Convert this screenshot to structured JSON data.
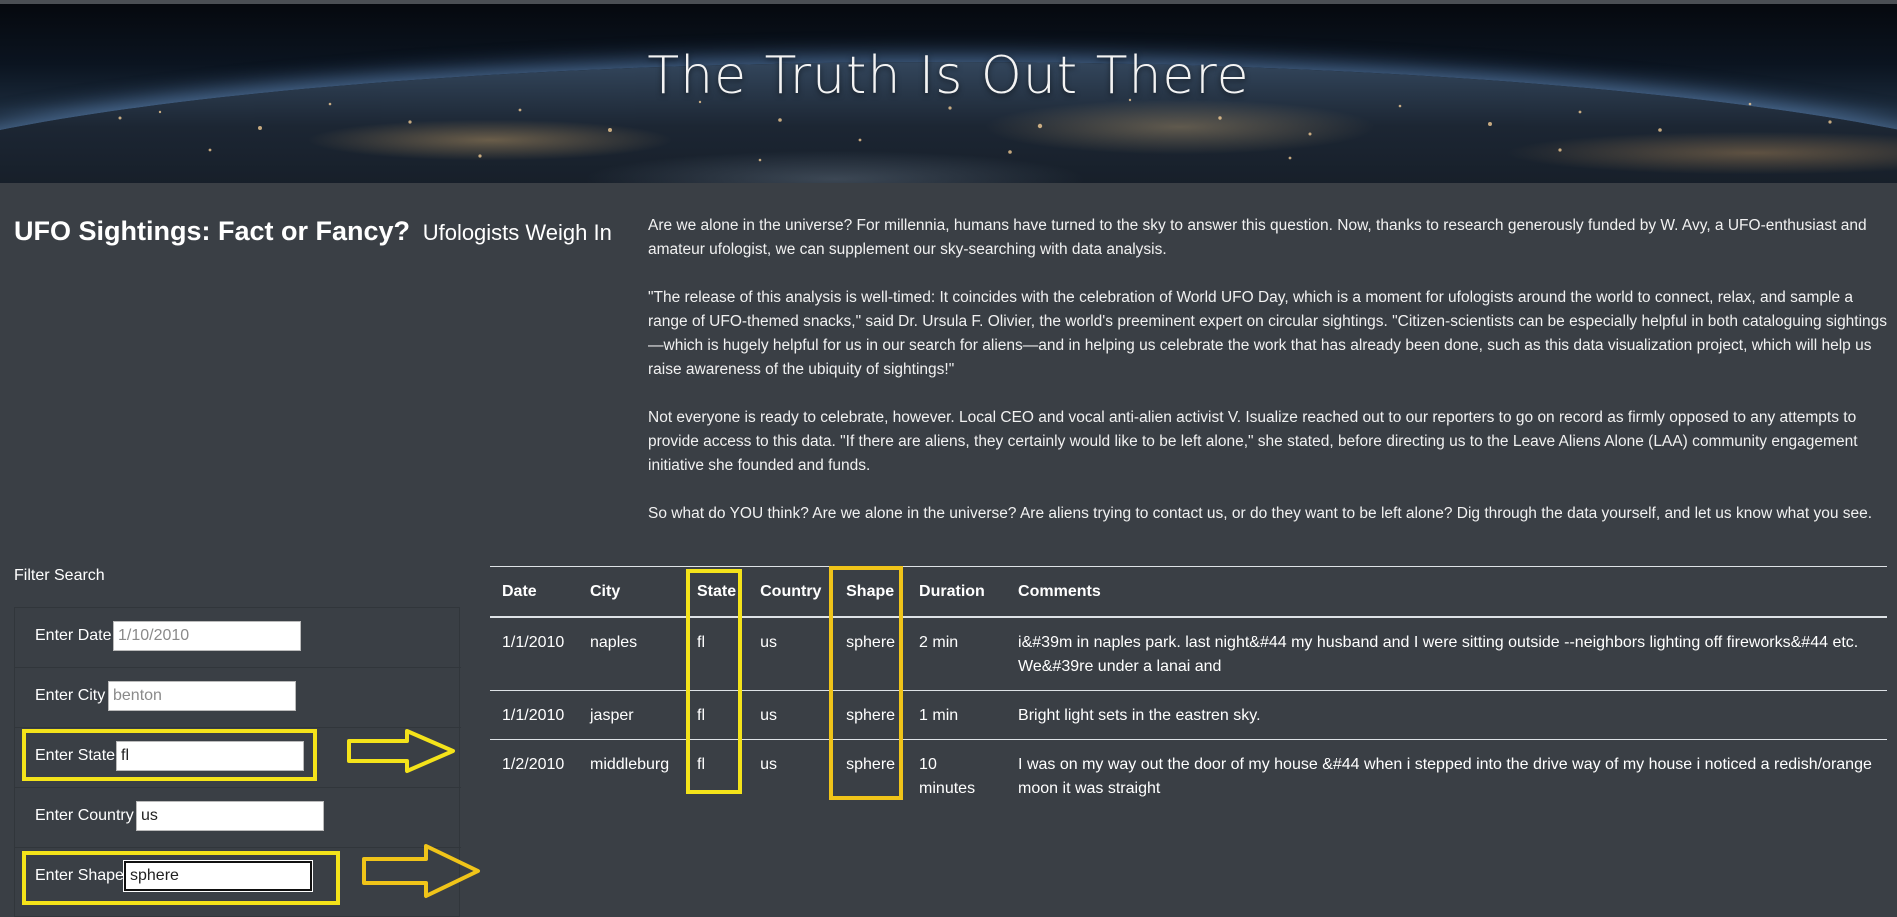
{
  "hero": {
    "title": "The Truth Is Out There"
  },
  "heading": {
    "main": "UFO Sightings: Fact or Fancy?",
    "sub": "Ufologists Weigh In"
  },
  "article": {
    "paragraphs": [
      "Are we alone in the universe? For millennia, humans have turned to the sky to answer this question. Now, thanks to research generously funded by W. Avy, a UFO-enthusiast and amateur ufologist, we can supplement our sky-searching with data analysis.",
      "\"The release of this analysis is well-timed: It coincides with the celebration of World UFO Day, which is a moment for ufologists around the world to connect, relax, and sample a range of UFO-themed snacks,\" said Dr. Ursula F. Olivier, the world's preeminent expert on circular sightings. \"Citizen-scientists can be especially helpful in both cataloguing sightings—which is hugely helpful for us in our search for aliens—and in helping us celebrate the work that has already been done, such as this data visualization project, which will help us raise awareness of the ubiquity of sightings!\"",
      "Not everyone is ready to celebrate, however. Local CEO and vocal anti-alien activist V. Isualize reached out to our reporters to go on record as firmly opposed to any attempts to provide access to this data. \"If there are aliens, they certainly would like to be left alone,\" she stated, before directing us to the Leave Aliens Alone (LAA) community engagement initiative she founded and funds.",
      "So what do YOU think? Are we alone in the universe? Are aliens trying to contact us, or do they want to be left alone? Dig through the data yourself, and let us know what you see."
    ]
  },
  "filters": {
    "title": "Filter Search",
    "date": {
      "label": "Enter Date",
      "value": "",
      "placeholder": "1/10/2010"
    },
    "city": {
      "label": "Enter City",
      "value": "",
      "placeholder": "benton"
    },
    "state": {
      "label": "Enter State",
      "value": "fl",
      "placeholder": ""
    },
    "country": {
      "label": "Enter Country",
      "value": "us",
      "placeholder": ""
    },
    "shape": {
      "label": "Enter Shape",
      "value": "sphere",
      "placeholder": ""
    }
  },
  "table": {
    "headers": [
      "Date",
      "City",
      "State",
      "Country",
      "Shape",
      "Duration",
      "Comments"
    ],
    "rows": [
      [
        "1/1/2010",
        "naples",
        "fl",
        "us",
        "sphere",
        "2 min",
        "i&#39m in naples park. last night&#44 my husband and I were sitting outside --neighbors lighting off fireworks&#44 etc. We&#39re under a lanai and"
      ],
      [
        "1/1/2010",
        "jasper",
        "fl",
        "us",
        "sphere",
        "1 min",
        "Bright light sets in the eastren sky."
      ],
      [
        "1/2/2010",
        "middleburg",
        "fl",
        "us",
        "sphere",
        "10 minutes",
        "I was on my way out the door of my house &#44 when i stepped into the drive way of my house i noticed a redish/orange moon it was straight"
      ]
    ]
  },
  "colors": {
    "background": "#3a3f45",
    "highlight": "#f4e31a",
    "arrow": "#f0c419"
  }
}
